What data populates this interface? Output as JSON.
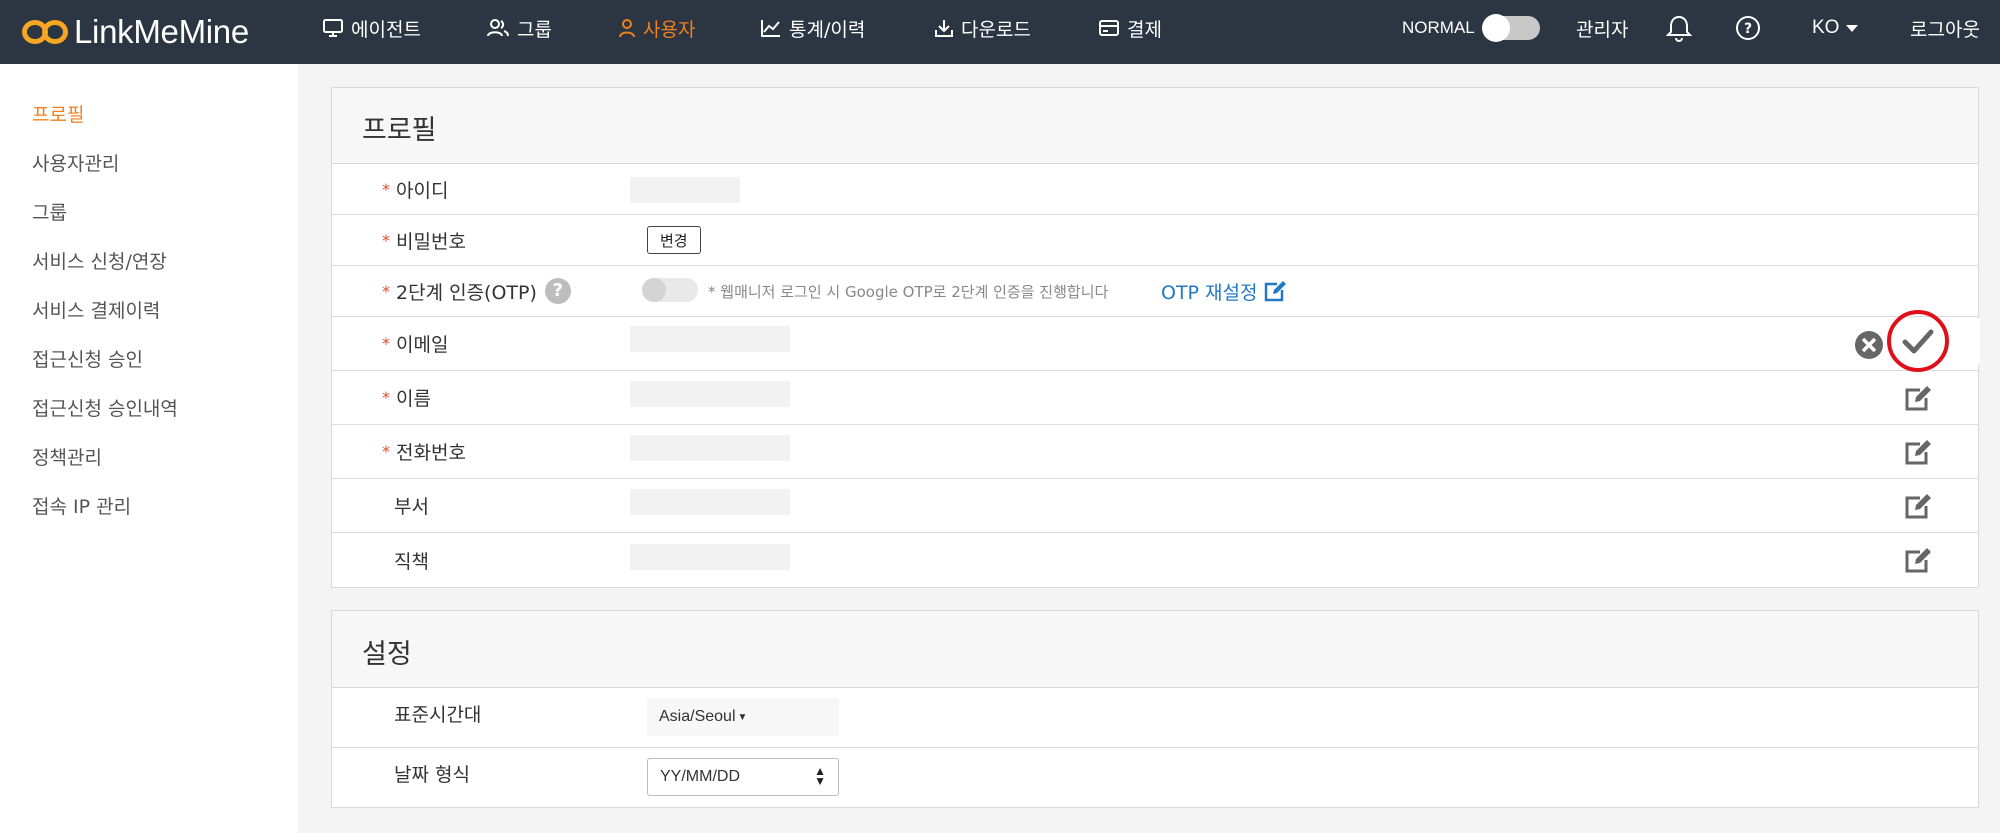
{
  "app": {
    "logo_text": "LinkMeMine"
  },
  "nav": {
    "items": [
      {
        "label": "에이전트",
        "icon": "monitor-icon"
      },
      {
        "label": "그룹",
        "icon": "users-icon"
      },
      {
        "label": "사용자",
        "icon": "user-icon",
        "active": true
      },
      {
        "label": "통계/이력",
        "icon": "chart-icon"
      },
      {
        "label": "다운로드",
        "icon": "download-icon"
      },
      {
        "label": "결제",
        "icon": "card-icon"
      }
    ],
    "mode_label": "NORMAL",
    "admin_label": "관리자",
    "lang_label": "KO",
    "logout_label": "로그아웃"
  },
  "sidebar": {
    "items": [
      {
        "label": "프로필",
        "active": true
      },
      {
        "label": "사용자관리"
      },
      {
        "label": "그룹"
      },
      {
        "label": "서비스 신청/연장"
      },
      {
        "label": "서비스 결제이력"
      },
      {
        "label": "접근신청 승인"
      },
      {
        "label": "접근신청 승인내역"
      },
      {
        "label": "정책관리"
      },
      {
        "label": "접속 IP 관리"
      }
    ]
  },
  "profile": {
    "title": "프로필",
    "required_mark": "*",
    "fields": {
      "id": {
        "label": "아이디",
        "required": true
      },
      "password": {
        "label": "비밀번호",
        "required": true,
        "button_label": "변경"
      },
      "otp": {
        "label": "2단계 인증(OTP)",
        "required": true,
        "help": "?",
        "description": "* 웹매니저 로그인 시 Google OTP로 2단계 인증을 진행합니다",
        "reset_label": "OTP 재설정",
        "enabled": false
      },
      "email": {
        "label": "이메일",
        "required": true
      },
      "name": {
        "label": "이름",
        "required": true
      },
      "phone": {
        "label": "전화번호",
        "required": true
      },
      "department": {
        "label": "부서",
        "required": false
      },
      "position": {
        "label": "직책",
        "required": false
      }
    }
  },
  "settings": {
    "title": "설정",
    "timezone": {
      "label": "표준시간대",
      "value": "Asia/Seoul"
    },
    "date_format": {
      "label": "날짜 형식",
      "value": "YY/MM/DD"
    }
  },
  "colors": {
    "topbar": "#2c3542",
    "accent": "#f0801e",
    "link": "#2378c6",
    "highlight_circle": "#e0101a"
  }
}
